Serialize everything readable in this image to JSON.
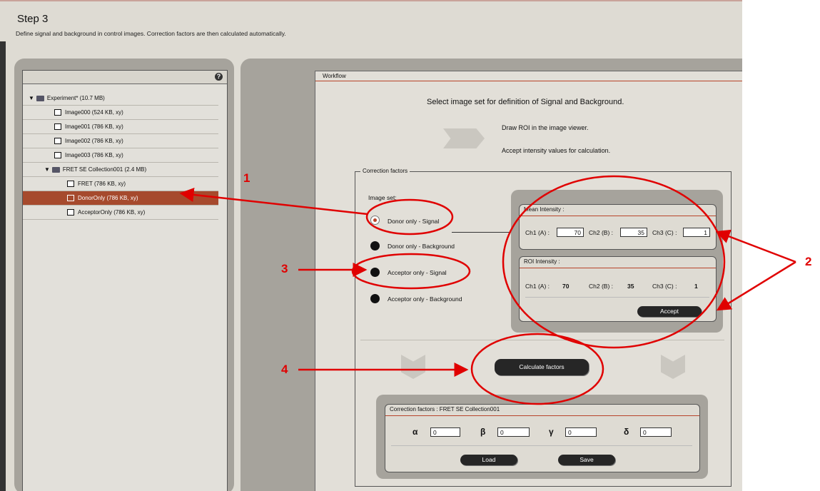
{
  "header": {
    "title": "Step 3",
    "subtitle": "Define signal and background in control images. Correction factors are then calculated automatically."
  },
  "tree": {
    "help_glyph": "?",
    "items": [
      {
        "label": "Experiment* (10.7 MB)",
        "kind": "folder",
        "level": 0
      },
      {
        "label": "Image000 (524 KB, xy)",
        "kind": "image",
        "level": 1
      },
      {
        "label": "Image001 (786 KB, xy)",
        "kind": "image",
        "level": 1
      },
      {
        "label": "Image002 (786 KB, xy)",
        "kind": "image",
        "level": 1
      },
      {
        "label": "Image003 (786 KB, xy)",
        "kind": "image",
        "level": 1
      },
      {
        "label": "FRET SE Collection001 (2.4 MB)",
        "kind": "folder",
        "level": 1
      },
      {
        "label": "FRET (786 KB, xy)",
        "kind": "image",
        "level": 2
      },
      {
        "label": "DonorOnly (786 KB, xy)",
        "kind": "image",
        "level": 2,
        "selected": true
      },
      {
        "label": "AcceptorOnly (786 KB, xy)",
        "kind": "image",
        "level": 2
      }
    ]
  },
  "workflow": {
    "title": "Workflow",
    "instruction": "Select image set for definition of Signal and Background.",
    "step_draw": "Draw ROI in the image viewer.",
    "step_accept": "Accept intensity values for calculation."
  },
  "correction": {
    "legend": "Correction factors",
    "image_set_label": "Image set:",
    "options": [
      {
        "label": "Donor only - Signal",
        "selected": true
      },
      {
        "label": "Donor only - Background",
        "selected": false
      },
      {
        "label": "Acceptor only - Signal",
        "selected": false
      },
      {
        "label": "Acceptor only - Background",
        "selected": false
      }
    ],
    "mean": {
      "title": "Mean Intensity :",
      "ch1_label": "Ch1 (A) :",
      "ch1_value": "70",
      "ch2_label": "Ch2 (B) :",
      "ch2_value": "35",
      "ch3_label": "Ch3 (C) :",
      "ch3_value": "1"
    },
    "roi": {
      "title": "ROI Intensity :",
      "ch1_label": "Ch1 (A) :",
      "ch1_value": "70",
      "ch2_label": "Ch2 (B) :",
      "ch2_value": "35",
      "ch3_label": "Ch3 (C) :",
      "ch3_value": "1",
      "accept_label": "Accept"
    },
    "calculate_label": "Calculate factors",
    "factors": {
      "title": "Correction factors : FRET SE Collection001",
      "alpha_symbol": "α",
      "alpha_value": "0",
      "beta_symbol": "β",
      "beta_value": "0",
      "gamma_symbol": "γ",
      "gamma_value": "0",
      "delta_symbol": "δ",
      "delta_value": "0",
      "load_label": "Load",
      "save_label": "Save"
    }
  },
  "annotations": {
    "n1": "1",
    "n2": "2",
    "n3": "3",
    "n4": "4",
    "color": "#e00000"
  }
}
